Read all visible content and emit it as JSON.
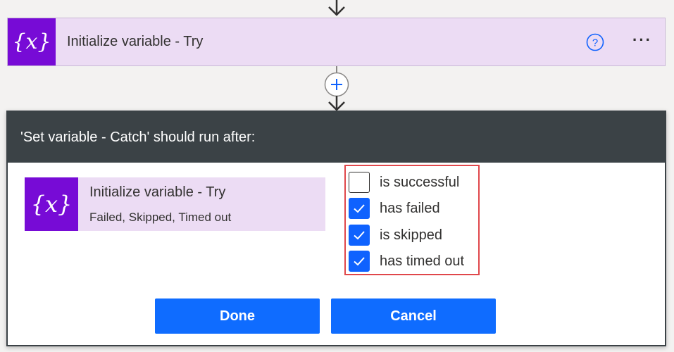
{
  "action_card": {
    "icon_text": "{x}",
    "title": "Initialize variable - Try",
    "more_label": "···"
  },
  "dialog": {
    "title": "'Set variable - Catch' should run after:",
    "predecessor": {
      "icon_text": "{x}",
      "title": "Initialize variable - Try",
      "status": "Failed, Skipped, Timed out"
    },
    "options": [
      {
        "label": "is successful",
        "checked": false
      },
      {
        "label": "has failed",
        "checked": true
      },
      {
        "label": "is skipped",
        "checked": true
      },
      {
        "label": "has timed out",
        "checked": true
      }
    ],
    "done_label": "Done",
    "cancel_label": "Cancel"
  },
  "colors": {
    "accent": "#0f6cff",
    "variable_icon_bg": "#770bd6",
    "card_bg": "#ecdcf4",
    "dialog_header_bg": "#3b4246",
    "highlight_border": "#e0474b"
  },
  "icons": [
    "arrow-down-icon",
    "variable-icon",
    "help-icon",
    "more-icon",
    "add-step-icon",
    "checkmark-icon"
  ]
}
